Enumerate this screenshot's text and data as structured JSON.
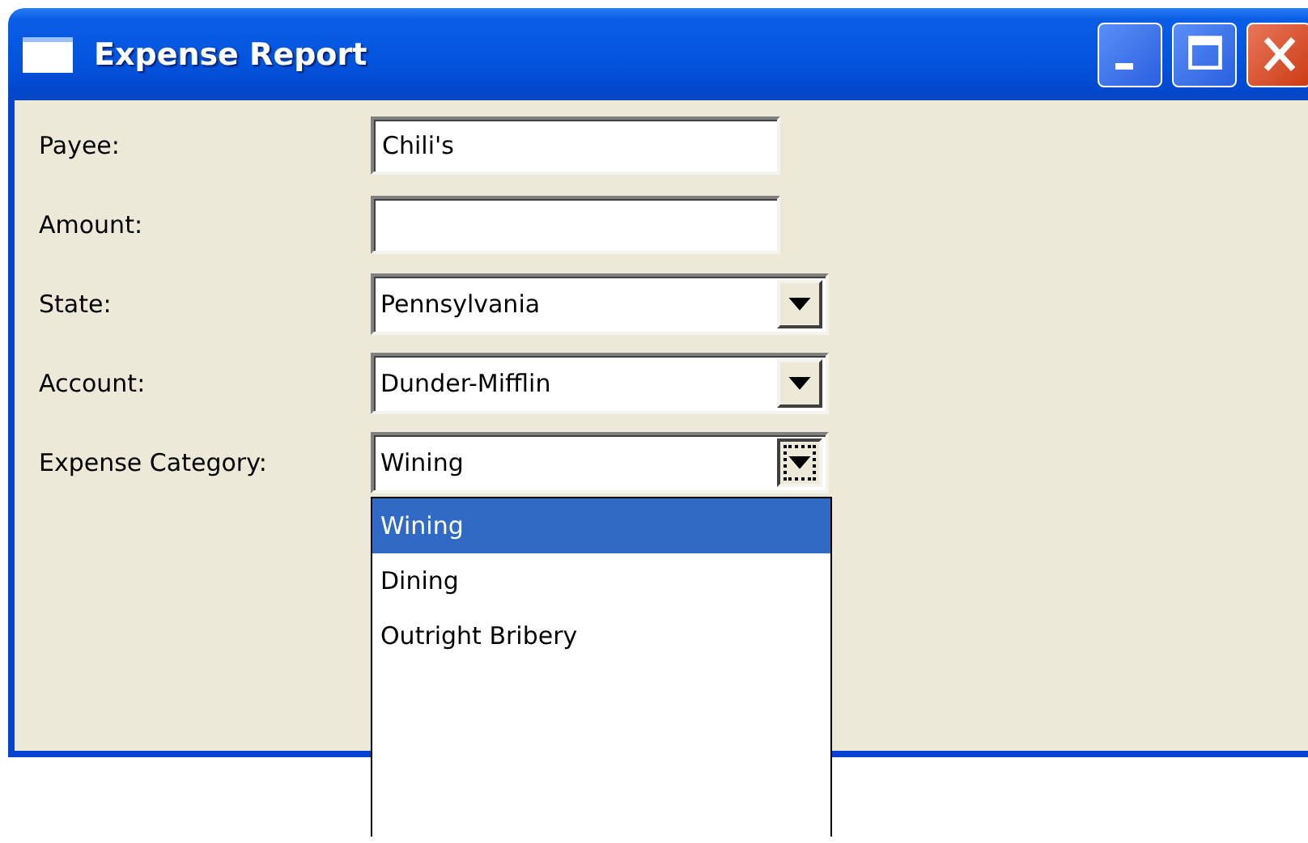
{
  "window": {
    "title": "Expense Report"
  },
  "fields": [
    {
      "kind": "text",
      "label": "Payee:",
      "value": "Chili's"
    },
    {
      "kind": "text",
      "label": "Amount:"
    },
    {
      "kind": "combo",
      "label": "State:",
      "value": "Pennsylvania",
      "expanded": false
    },
    {
      "kind": "combo",
      "label": "Account:",
      "value": "Dunder-Mifflin",
      "expanded": false
    },
    {
      "kind": "combo",
      "label": "Expense Category:",
      "value": "Wining",
      "expanded": true,
      "options": [
        {
          "label": "Wining",
          "selected": true
        },
        {
          "label": "Dining",
          "selected": false
        },
        {
          "label": "Outright Bribery",
          "selected": false
        }
      ]
    }
  ]
}
